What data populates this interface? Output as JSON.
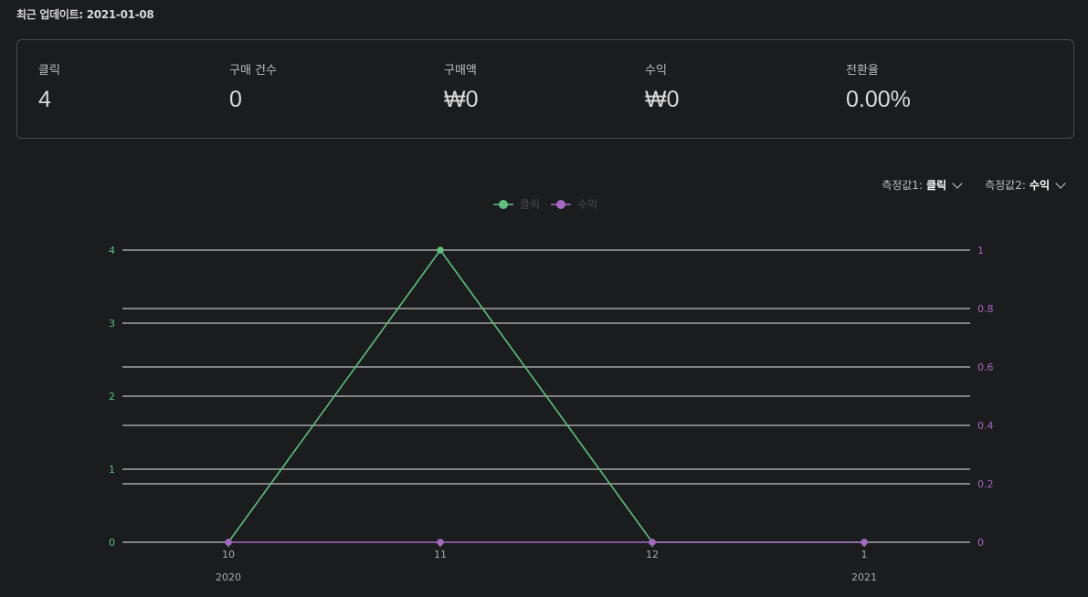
{
  "header": {
    "updated_label": "최근 업데이트:",
    "updated_date": "2021-01-08"
  },
  "summary": [
    {
      "label": "클릭",
      "value": "4"
    },
    {
      "label": "구매 건수",
      "value": "0"
    },
    {
      "label": "구매액",
      "value": "₩0"
    },
    {
      "label": "수익",
      "value": "₩0"
    },
    {
      "label": "전환율",
      "value": "0.00%"
    }
  ],
  "selectors": {
    "metric1_label": "측정값1:",
    "metric1_value": "클릭",
    "metric2_label": "측정값2:",
    "metric2_value": "수익"
  },
  "colors": {
    "series1": "#5fbf7f",
    "series2": "#a468c2",
    "grid": "#e8e8e8"
  },
  "chart_data": {
    "type": "line",
    "title": "",
    "legend_position": "top-center",
    "x": [
      "10",
      "11",
      "12",
      "1"
    ],
    "x_year_labels": [
      {
        "at": "10",
        "label": "2020"
      },
      {
        "at": "1",
        "label": "2021"
      }
    ],
    "y_left": {
      "ticks": [
        "0",
        "1",
        "2",
        "3",
        "4"
      ],
      "range": [
        0,
        4
      ]
    },
    "y_right": {
      "ticks": [
        "0",
        "0.2",
        "0.4",
        "0.6",
        "0.8",
        "1"
      ],
      "range": [
        0,
        1
      ]
    },
    "grid": true,
    "series": [
      {
        "name": "클릭",
        "axis": "left",
        "values": [
          0,
          4,
          0,
          0
        ]
      },
      {
        "name": "수익",
        "axis": "right",
        "values": [
          0,
          0,
          0,
          0
        ]
      }
    ]
  }
}
